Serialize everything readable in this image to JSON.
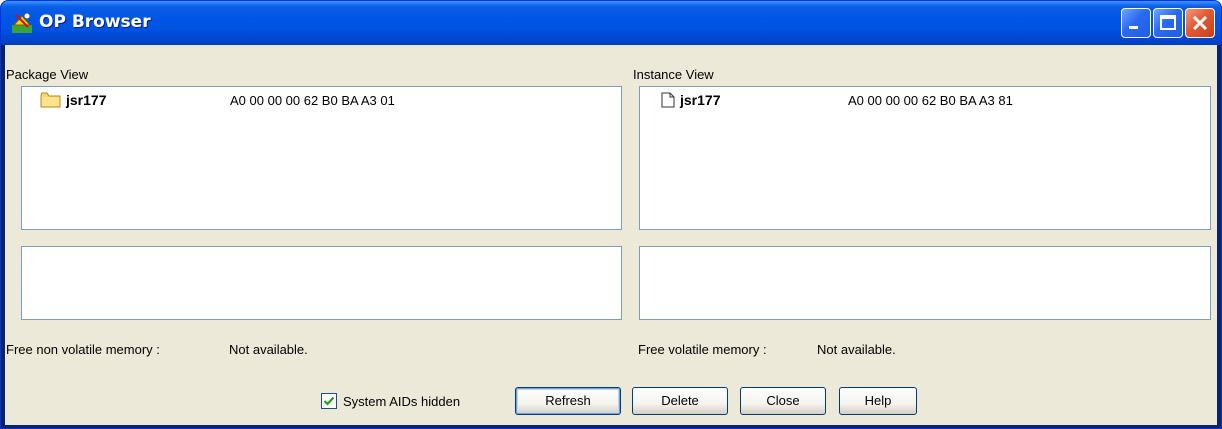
{
  "window": {
    "title": "OP Browser",
    "controls": {
      "minimize": "minimize-icon",
      "maximize": "maximize-icon",
      "close": "close-icon"
    }
  },
  "package_view": {
    "label": "Package View",
    "items": [
      {
        "icon": "folder-icon",
        "name": "jsr177",
        "aid": "A0 00 00 00 62 B0 BA A3 01"
      }
    ]
  },
  "instance_view": {
    "label": "Instance View",
    "items": [
      {
        "icon": "document-icon",
        "name": "jsr177",
        "aid": "A0 00 00 00 62 B0 BA A3 81"
      }
    ]
  },
  "memory": {
    "non_volatile_label": "Free non volatile memory :",
    "non_volatile_value": "Not available.",
    "volatile_label": "Free volatile memory :",
    "volatile_value": "Not available."
  },
  "footer": {
    "checkbox_label": "System AIDs hidden",
    "checkbox_checked": true,
    "buttons": {
      "refresh": "Refresh",
      "delete": "Delete",
      "close": "Close",
      "help": "Help"
    }
  },
  "colors": {
    "titlebar": "#0054e3",
    "client": "#ece9d8",
    "list_border": "#7f9db9"
  }
}
